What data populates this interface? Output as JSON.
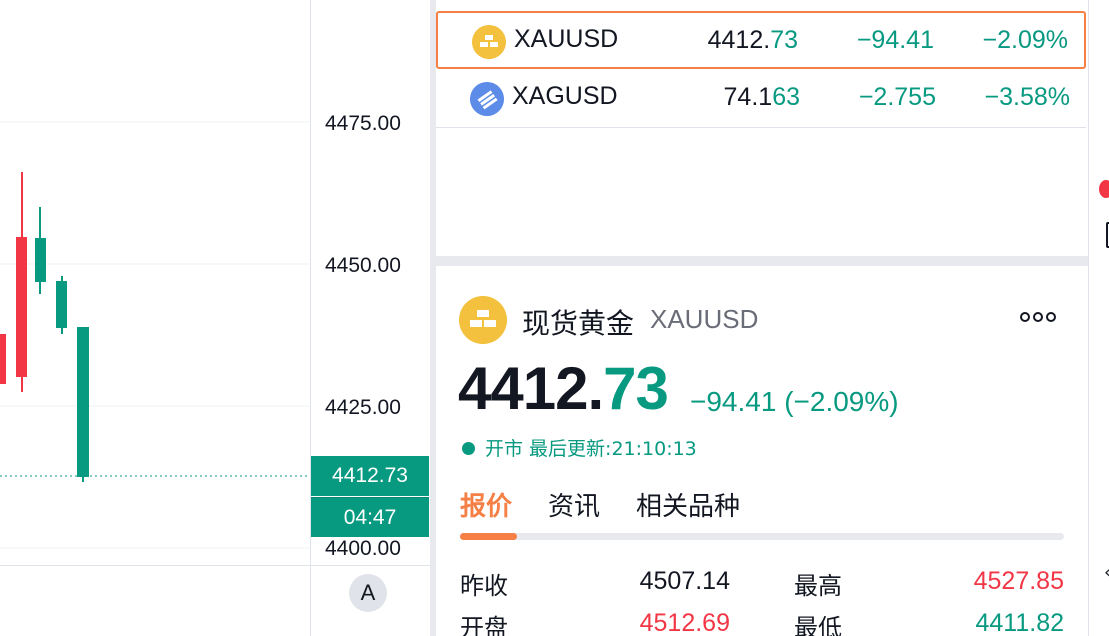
{
  "chart": {
    "price_ticks": [
      "4475.00",
      "4450.00",
      "4425.00",
      "4400.00"
    ],
    "last_price": "4412.73",
    "countdown": "04:47",
    "auto_scale_label": "A",
    "up_color": "#f23645",
    "down_color": "#089981"
  },
  "watchlist": [
    {
      "icon": "gold-bars-icon",
      "symbol": "XAUUSD",
      "last_main": "4412.",
      "last_tail": "73",
      "change": "−94.41",
      "change_pct": "−2.09%",
      "selected": true
    },
    {
      "icon": "silver-bars-icon",
      "symbol": "XAGUSD",
      "last_main": "74.1",
      "last_tail": "63",
      "change": "−2.755",
      "change_pct": "−3.58%",
      "selected": false
    }
  ],
  "details": {
    "name": "现货黄金",
    "symbol": "XAUUSD",
    "price_main": "4412.",
    "price_tail": "73",
    "change": "−94.41 (−2.09%)",
    "status": "开市 最后更新:21:10:13",
    "tabs": [
      "报价",
      "资讯",
      "相关品种"
    ],
    "stats": [
      {
        "label": "昨收",
        "value": "4507.14",
        "color": "#131722"
      },
      {
        "label": "最高",
        "value": "4527.85",
        "color": "#f23645"
      },
      {
        "label": "开盘",
        "value": "4512.69",
        "color": "#f23645"
      },
      {
        "label": "最低",
        "value": "4411.82",
        "color": "#089981"
      }
    ]
  },
  "accent_color": "#f57f45"
}
